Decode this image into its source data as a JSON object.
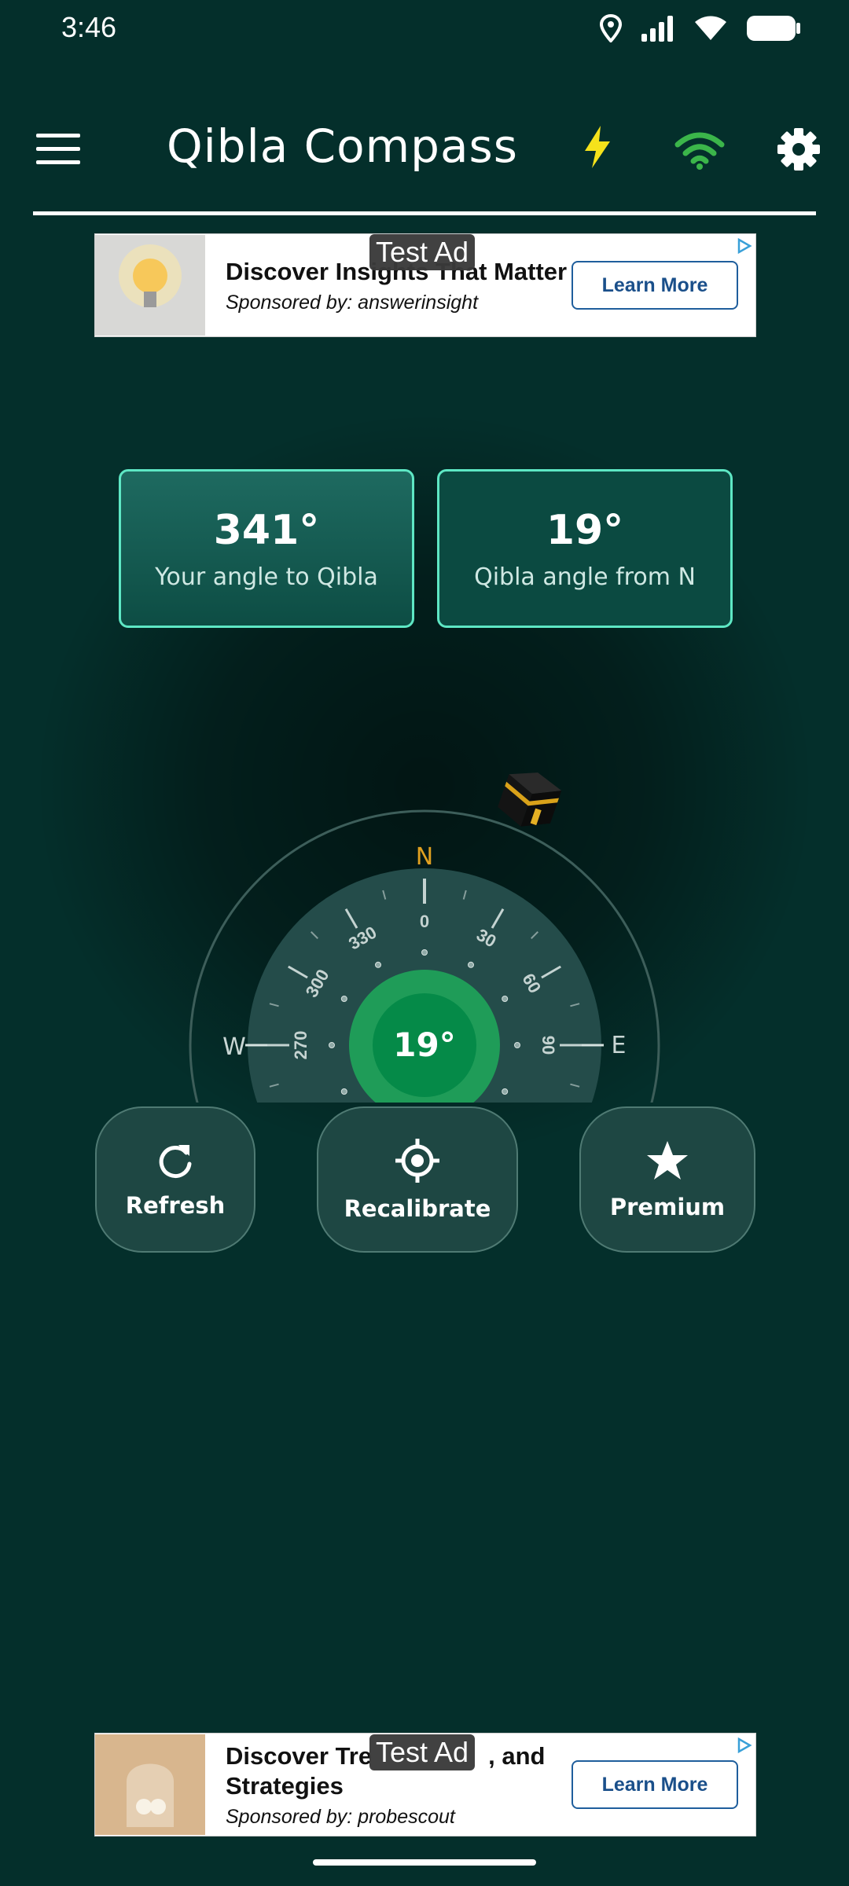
{
  "status_bar": {
    "time": "3:46",
    "icons": [
      "location-icon",
      "signal-icon",
      "wifi-icon",
      "battery-icon"
    ]
  },
  "app_bar": {
    "title": "Qibla Compass",
    "icons": [
      "menu-icon",
      "lightning-icon",
      "wifi-icon",
      "settings-icon"
    ],
    "colors": {
      "lightning": "#f5e21b",
      "wifi": "#3bb54a"
    }
  },
  "ad_top": {
    "badge": "Test Ad",
    "headline": "Discover Insights That Matter",
    "sponsor": "Sponsored by: answerinsight",
    "cta": "Learn More"
  },
  "cards": [
    {
      "value": "341°",
      "label": "Your angle to Qibla"
    },
    {
      "value": "19°",
      "label": "Qibla angle from N"
    }
  ],
  "compass": {
    "center_value": "19°",
    "cardinals": {
      "north": "N",
      "west": "W",
      "east": "E"
    },
    "tick_labels": [
      "0",
      "30",
      "60",
      "90",
      "270",
      "300",
      "330"
    ],
    "qibla_bearing_deg": 19,
    "icon": "kaaba-icon"
  },
  "actions": [
    {
      "label": "Refresh",
      "icon": "refresh-icon"
    },
    {
      "label": "Recalibrate",
      "icon": "crosshair-icon"
    },
    {
      "label": "Premium",
      "icon": "star-icon"
    }
  ],
  "ad_bottom": {
    "badge": "Test Ad",
    "headline_line1": "Discover Tre",
    "headline_line1_end": ", and",
    "headline_line2": "Strategies",
    "sponsor": "Sponsored by: probescout",
    "cta": "Learn More"
  },
  "theme": {
    "background": "#042f2b",
    "card_border": "#5ee7c4",
    "accent_green": "#1faa5a",
    "north_color": "#e0a020"
  }
}
